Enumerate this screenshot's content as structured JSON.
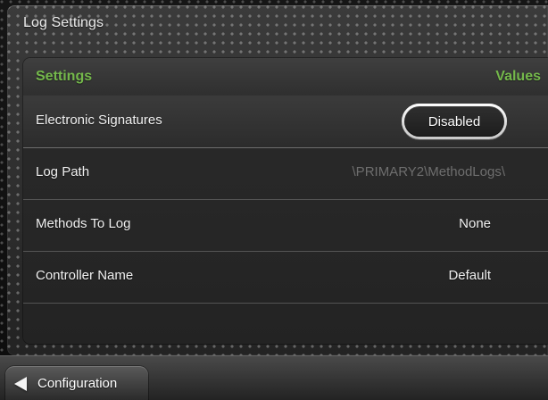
{
  "window": {
    "title": "Log Settings"
  },
  "table": {
    "headers": {
      "settings": "Settings",
      "values": "Values"
    },
    "rows": [
      {
        "label": "Electronic Signatures",
        "value": "Disabled"
      },
      {
        "label": "Log Path",
        "value": "\\PRIMARY2\\MethodLogs\\"
      },
      {
        "label": "Methods To Log",
        "value": "None"
      },
      {
        "label": "Controller Name",
        "value": "Default"
      }
    ]
  },
  "navigation": {
    "back_label": "Configuration"
  },
  "icons": {
    "back": "back-arrow-icon"
  },
  "colors": {
    "header_accent": "#74b84b",
    "muted_value": "#6e6e6e"
  }
}
